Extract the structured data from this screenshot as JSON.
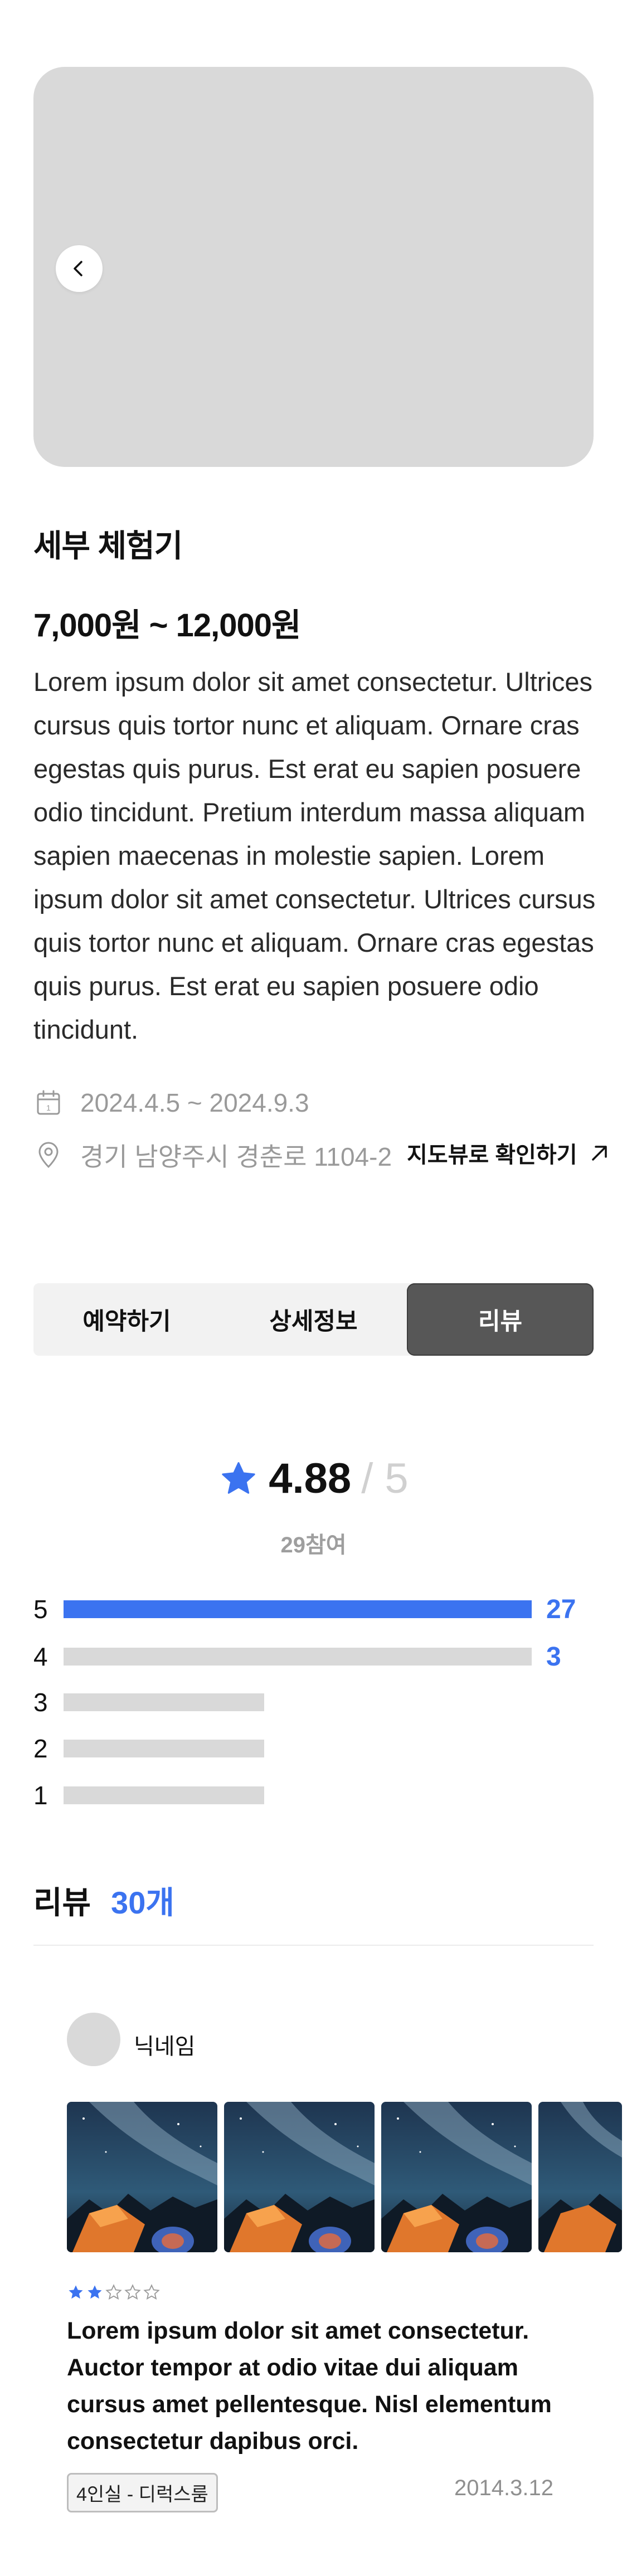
{
  "product": {
    "title": "세부 체험기",
    "price": "7,000원 ~ 12,000원",
    "description": "Lorem ipsum dolor sit amet consectetur. Ultrices cursus quis tortor nunc et aliquam. Ornare cras egestas quis purus. Est erat eu sapien posuere odio tincidunt. Pretium interdum massa aliquam sapien maecenas in molestie sapien. Lorem ipsum dolor sit amet consectetur. Ultrices cursus quis tortor nunc et aliquam. Ornare cras egestas quis purus. Est erat eu sapien posuere odio tincidunt.",
    "date_range": "2024.4.5 ~ 2024.9.3",
    "address": "경기 남양주시 경춘로 1104-2",
    "map_link": "지도뷰로 확인하기"
  },
  "tabs": [
    {
      "label": "예약하기",
      "active": false
    },
    {
      "label": "상세정보",
      "active": false
    },
    {
      "label": "리뷰",
      "active": true
    }
  ],
  "rating": {
    "score": "4.88",
    "out_of": "/ 5",
    "participants": "29참여",
    "distribution": [
      {
        "star": "5",
        "count": "27",
        "fraction": 1.0
      },
      {
        "star": "4",
        "count": "3",
        "fraction": 1.0
      },
      {
        "star": "3",
        "count": "",
        "fraction": 0.43
      },
      {
        "star": "2",
        "count": "",
        "fraction": 0.43
      },
      {
        "star": "1",
        "count": "",
        "fraction": 0.43
      }
    ]
  },
  "reviews_header": {
    "title": "리뷰",
    "count": "30개"
  },
  "review": {
    "nickname": "닉네임",
    "stars_filled": 2,
    "stars_total": 5,
    "text": "Lorem ipsum dolor sit amet consectetur. Auctor tempor at odio vitae dui aliquam cursus amet pellentesque. Nisl elementum consectetur dapibus orci.",
    "room": "4인실 - 디럭스룸",
    "date": "2014.3.12",
    "photo_count": 4
  },
  "colors": {
    "accent": "#3b73f0",
    "bar_empty": "#d9d9d9",
    "tab_active": "#575757",
    "placeholder": "#d9d9d9"
  },
  "icons": {
    "hero_prev": "chevron-left-icon",
    "calendar": "calendar-icon",
    "location": "location-pin-icon",
    "map_arrow": "arrow-up-right-icon",
    "rating_star": "star-icon"
  }
}
